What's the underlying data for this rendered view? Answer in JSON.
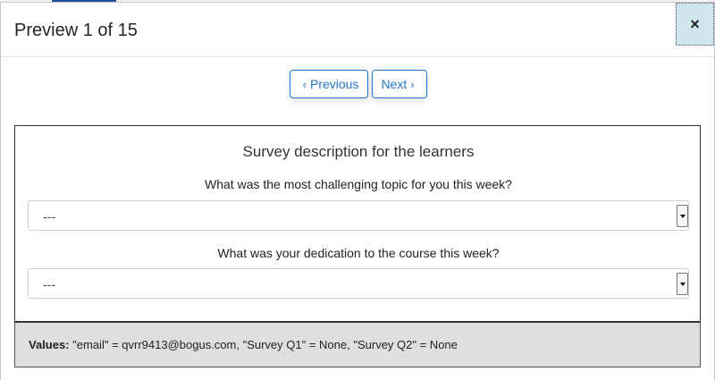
{
  "modal": {
    "title": "Preview 1 of 15",
    "close_symbol": "×"
  },
  "nav": {
    "previous_label": "Previous",
    "next_label": "Next",
    "previous_icon": "‹",
    "next_icon": "›"
  },
  "survey": {
    "title": "Survey description for the learners",
    "questions": [
      {
        "label": "What was the most challenging topic for you this week?",
        "selected": "---"
      },
      {
        "label": "What was your dedication to the course this week?",
        "selected": "---"
      }
    ]
  },
  "values": {
    "prefix": "Values:",
    "text": "\"email\" = qvrr9413@bogus.com, \"Survey Q1\" = None, \"Survey Q2\" = None"
  }
}
